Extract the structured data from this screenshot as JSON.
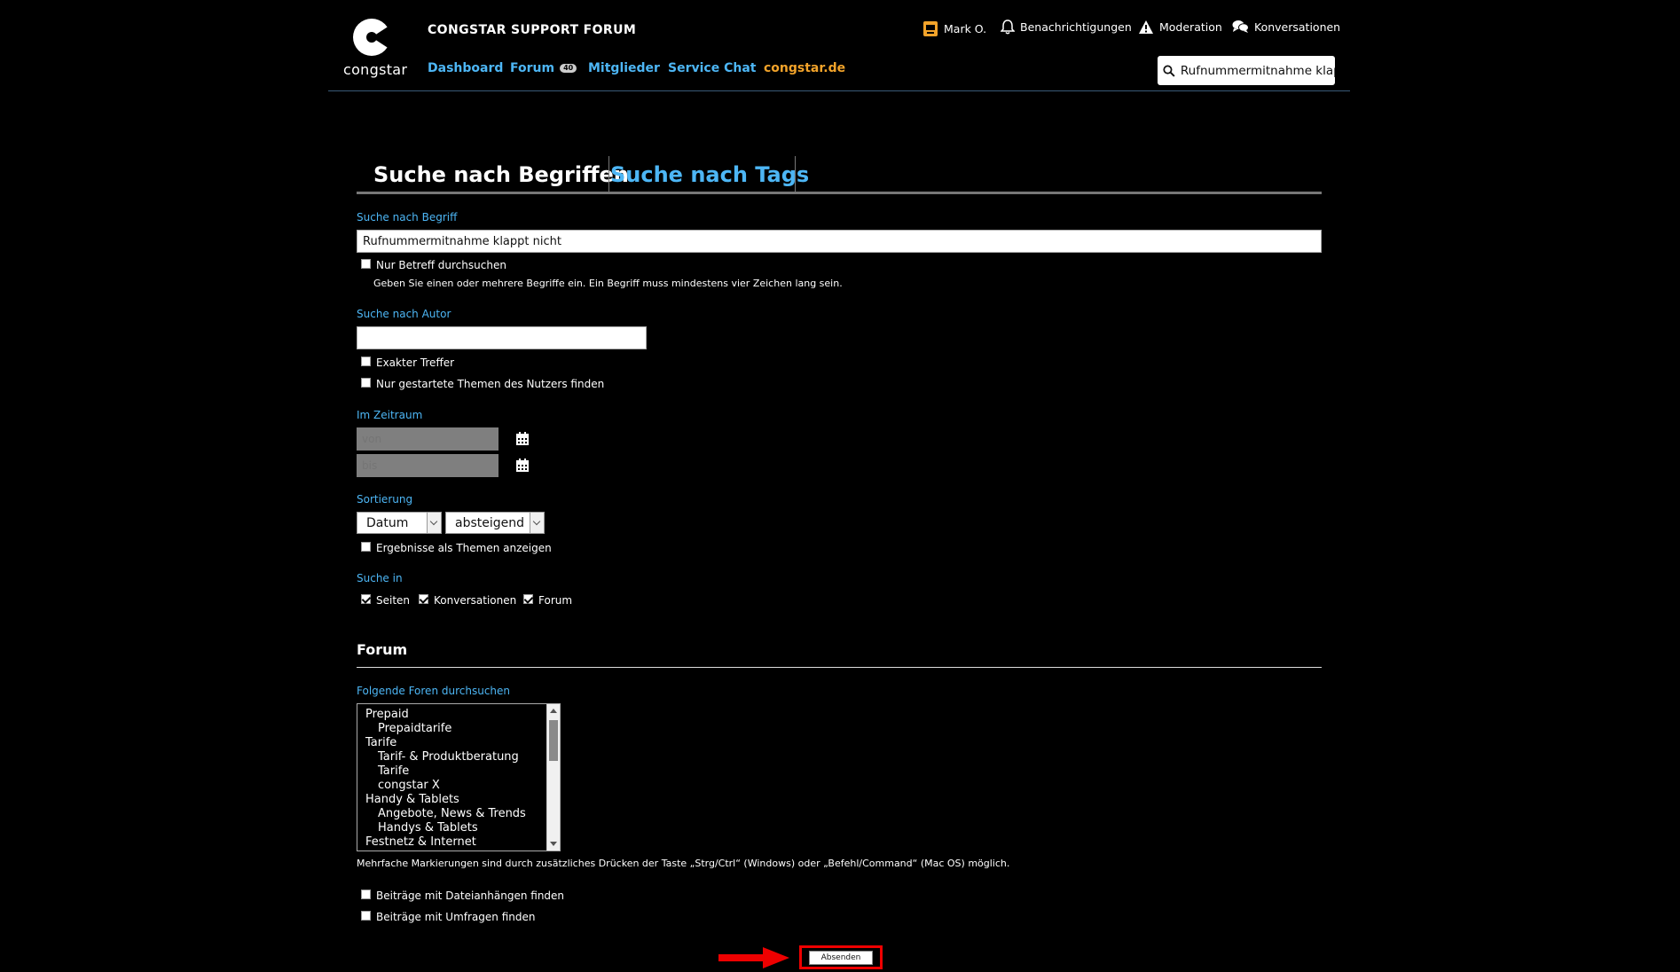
{
  "header": {
    "logo_text": "congstar",
    "forum_title": "CONGSTAR SUPPORT FORUM",
    "nav": [
      {
        "label": "Dashboard"
      },
      {
        "label": "Forum",
        "badge": "40"
      },
      {
        "label": "Mitglieder"
      },
      {
        "label": "Service Chat"
      },
      {
        "label": "congstar.de"
      }
    ],
    "user": {
      "name": "Mark O.",
      "notifications": "Benachrichtigungen",
      "moderation": "Moderation",
      "conversations": "Konversationen"
    },
    "search_value": "Rufnummermitnahme klappt"
  },
  "tabs": {
    "active": "Suche nach Begriffen",
    "inactive": "Suche nach Tags"
  },
  "term": {
    "label": "Suche nach Begriff",
    "value": "Rufnummermitnahme klappt nicht",
    "subject_only": {
      "label": "Nur Betreff durchsuchen",
      "checked": false
    },
    "hint": "Geben Sie einen oder mehrere Begriffe ein. Ein Begriff muss mindestens vier Zeichen lang sein."
  },
  "author": {
    "label": "Suche nach Autor",
    "value": "",
    "exact": {
      "label": "Exakter Treffer",
      "checked": false
    },
    "started_only": {
      "label": "Nur gestartete Themen des Nutzers finden",
      "checked": false
    }
  },
  "period": {
    "label": "Im Zeitraum",
    "from_placeholder": "von",
    "to_placeholder": "bis"
  },
  "sort": {
    "label": "Sortierung",
    "field": "Datum",
    "order": "absteigend",
    "as_topics": {
      "label": "Ergebnisse als Themen anzeigen",
      "checked": false
    }
  },
  "search_in": {
    "label": "Suche in",
    "options": [
      {
        "label": "Seiten",
        "checked": true
      },
      {
        "label": "Konversationen",
        "checked": true
      },
      {
        "label": "Forum",
        "checked": true
      }
    ]
  },
  "forum": {
    "title": "Forum",
    "list_label": "Folgende Foren durchsuchen",
    "items": [
      {
        "label": "Prepaid",
        "level": 0
      },
      {
        "label": "Prepaidtarife",
        "level": 1
      },
      {
        "label": "Tarife",
        "level": 0
      },
      {
        "label": "Tarif- & Produktberatung",
        "level": 1
      },
      {
        "label": "Tarife",
        "level": 1
      },
      {
        "label": "congstar X",
        "level": 1
      },
      {
        "label": "Handy & Tablets",
        "level": 0
      },
      {
        "label": "Angebote, News & Trends",
        "level": 1
      },
      {
        "label": "Handys & Tablets",
        "level": 1
      },
      {
        "label": "Festnetz & Internet",
        "level": 0
      }
    ],
    "multi_hint": "Mehrfache Markierungen sind durch zusätzliches Drücken der Taste „Strg/Ctrl“ (Windows) oder „Befehl/Command“ (Mac OS) möglich.",
    "attachments": {
      "label": "Beiträge mit Dateianhängen finden",
      "checked": false
    },
    "polls": {
      "label": "Beiträge mit Umfragen finden",
      "checked": false
    }
  },
  "submit_label": "Absenden",
  "colors": {
    "accent": "#4db6f5",
    "brand_orange": "#f2a32a",
    "annotation": "#e00000"
  }
}
